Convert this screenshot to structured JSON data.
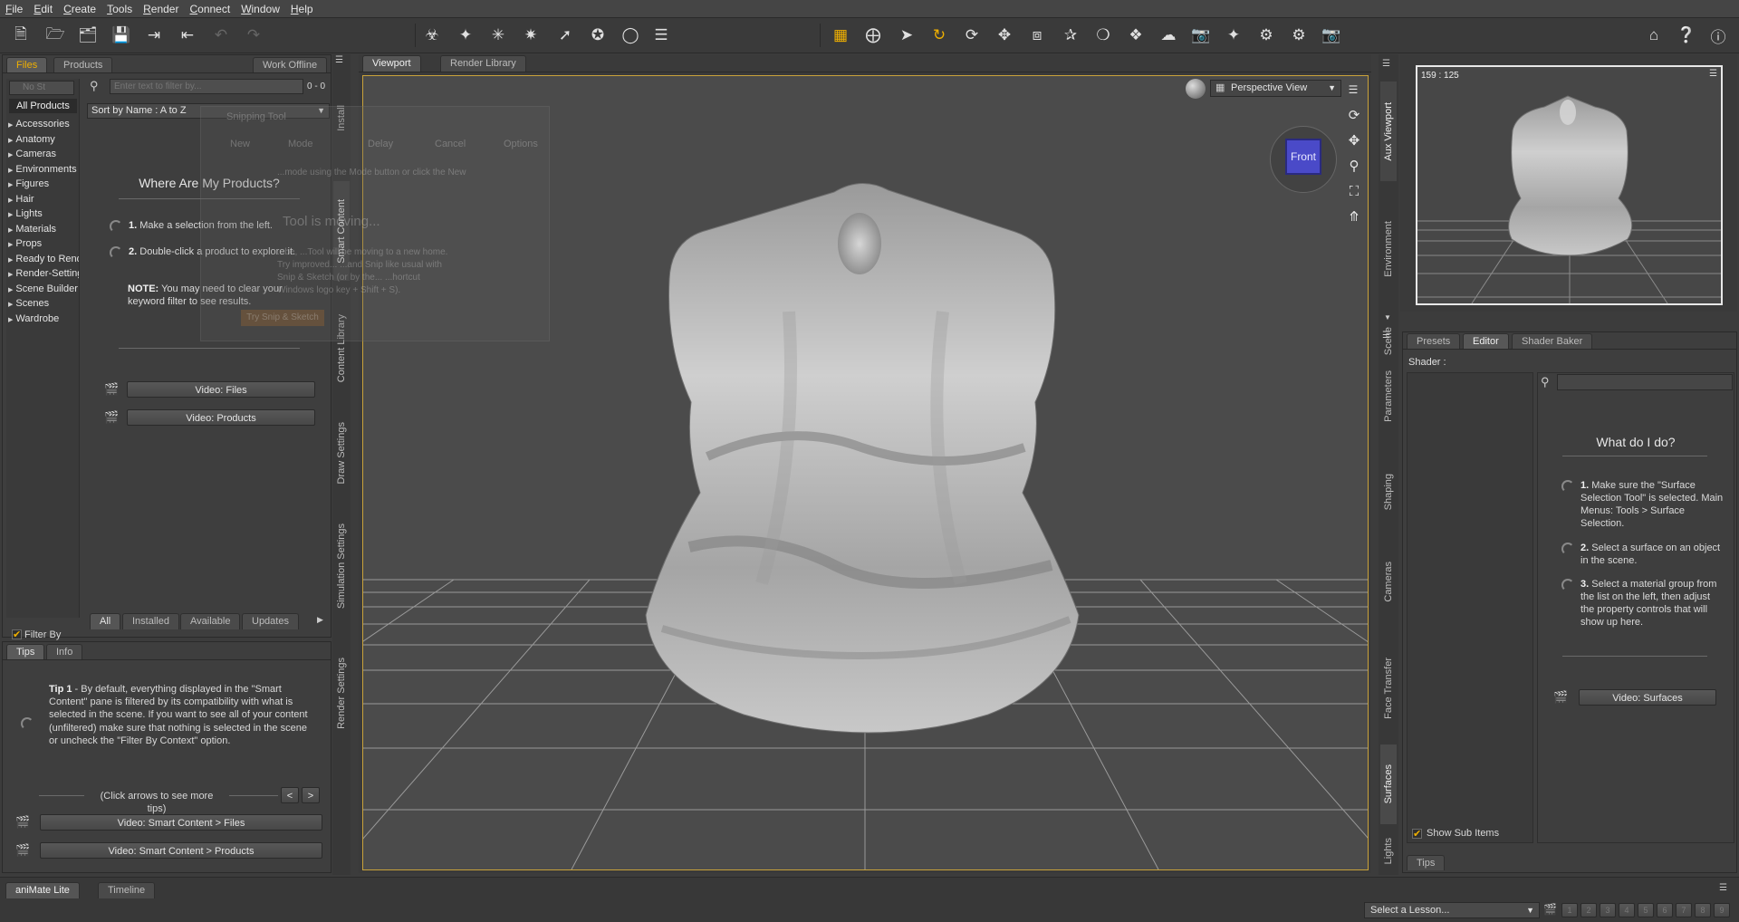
{
  "menu": [
    "File",
    "Edit",
    "Create",
    "Tools",
    "Render",
    "Connect",
    "Window",
    "Help"
  ],
  "colors": {
    "accent": "#f0b000",
    "bg": "#3c3c3c",
    "viewport": "#4a4a4a",
    "cube": "#4a4ac8"
  },
  "toolbar": {
    "file_icons": [
      "new-file-icon",
      "open-icon",
      "merge-icon",
      "save-icon",
      "import-icon",
      "export-icon",
      "undo-icon",
      "redo-icon",
      "align-icon"
    ],
    "create_icons": [
      "figure-icon",
      "pose-icon",
      "camera-light-icon",
      "spotlight-icon",
      "distant-light-icon",
      "point-light-icon",
      "null-icon"
    ],
    "tool_icons": [
      "grid-icon",
      "universal-icon",
      "select-icon",
      "rotate-icon",
      "spin-icon",
      "translate-icon",
      "scale-icon",
      "joint-icon",
      "node-weight-icon",
      "surface-icon",
      "geometry-icon",
      "camera-icon",
      "region-icon",
      "render-settings-icon",
      "render-icon",
      "snapshot-icon"
    ],
    "right_icons": [
      "home-ds-icon",
      "whats-this-icon",
      "help-icon"
    ]
  },
  "left": {
    "tabs": [
      "Files",
      "Products"
    ],
    "work_offline": "Work Offline",
    "filter_dropdown": "No St",
    "search_placeholder": "Enter text to filter by...",
    "count": "0 - 0",
    "all_products": "All Products",
    "sort": "Sort by Name : A to Z",
    "categories": [
      "Accessories",
      "Anatomy",
      "Cameras",
      "Environments",
      "Figures",
      "Hair",
      "Lights",
      "Materials",
      "Props",
      "Ready to Render",
      "Render-Settings",
      "Scene Builder",
      "Scenes",
      "Wardrobe"
    ],
    "heading": "Where Are My Products?",
    "step1_num": "1.",
    "step1": "Make a selection from the left.",
    "step2_num": "2.",
    "step2": "Double-click a product to explore it.",
    "note_label": "NOTE:",
    "note": "You may need to clear your keyword filter to see results.",
    "video_files": "Video: Files",
    "video_products": "Video: Products",
    "filter_context": "Filter By Context",
    "bottom_tabs": [
      "All",
      "Installed",
      "Available",
      "Updates"
    ],
    "ghost": {
      "title": "Snipping Tool",
      "new": "New",
      "mode": "Mode",
      "delay": "Delay",
      "cancel": "Cancel",
      "options": "Options",
      "hint": "...mode using the Mode button or click the New",
      "moving": "Tool is moving...",
      "body": "...be, ...Tool will be moving to a new home. Try improved... ...and Snip like usual with Snip & Sketch (or by the... ...hortcut Windows logo key + Shift + S).",
      "button": "Try Snip & Sketch"
    }
  },
  "left_vtabs": [
    "Install",
    "Smart Content",
    "Content Library",
    "Draw Settings",
    "Simulation Settings",
    "Render Settings"
  ],
  "tips": {
    "tabs": [
      "Tips",
      "Info"
    ],
    "tip_label": "Tip 1",
    "tip_text": " - By default, everything displayed in the \"Smart Content\" pane is filtered by its compatibility with what is selected in the scene. If you want to see all of your content (unfiltered) make sure that nothing is selected in the scene or uncheck the \"Filter By Context\" option.",
    "nav_hint": "(Click arrows to see more tips)",
    "prev": "<",
    "next": ">",
    "video1": "Video: Smart Content > Files",
    "video2": "Video: Smart Content > Products"
  },
  "viewport": {
    "tabs": [
      "Viewport",
      "Render Library"
    ],
    "view": "Perspective View",
    "cube_label": "Front"
  },
  "aux": {
    "label": "159 : 125"
  },
  "right_vtabs_top": [
    "Aux Viewport",
    "Environment",
    "Scene"
  ],
  "right_vtabs": [
    "Parameters",
    "Shaping",
    "Cameras",
    "Face Transfer",
    "Surfaces",
    "Lights"
  ],
  "surfaces": {
    "tabs": [
      "Presets",
      "Editor",
      "Shader Baker"
    ],
    "shader_label": "Shader :",
    "heading": "What do I do?",
    "s1_num": "1.",
    "s1": "Make sure the \"Surface Selection Tool\" is selected. Main Menus: Tools > Surface Selection.",
    "s2_num": "2.",
    "s2": "Select a surface on an object in the scene.",
    "s3_num": "3.",
    "s3": "Select a material group from the list on the left, then adjust the property controls that will show up here.",
    "video": "Video: Surfaces",
    "show_sub": "Show Sub Items",
    "tips_tab": "Tips"
  },
  "bottom": {
    "tabs": [
      "aniMate Lite",
      "Timeline"
    ],
    "lesson": "Select a Lesson...",
    "pages": [
      "1",
      "2",
      "3",
      "4",
      "5",
      "6",
      "7",
      "8",
      "9"
    ]
  }
}
